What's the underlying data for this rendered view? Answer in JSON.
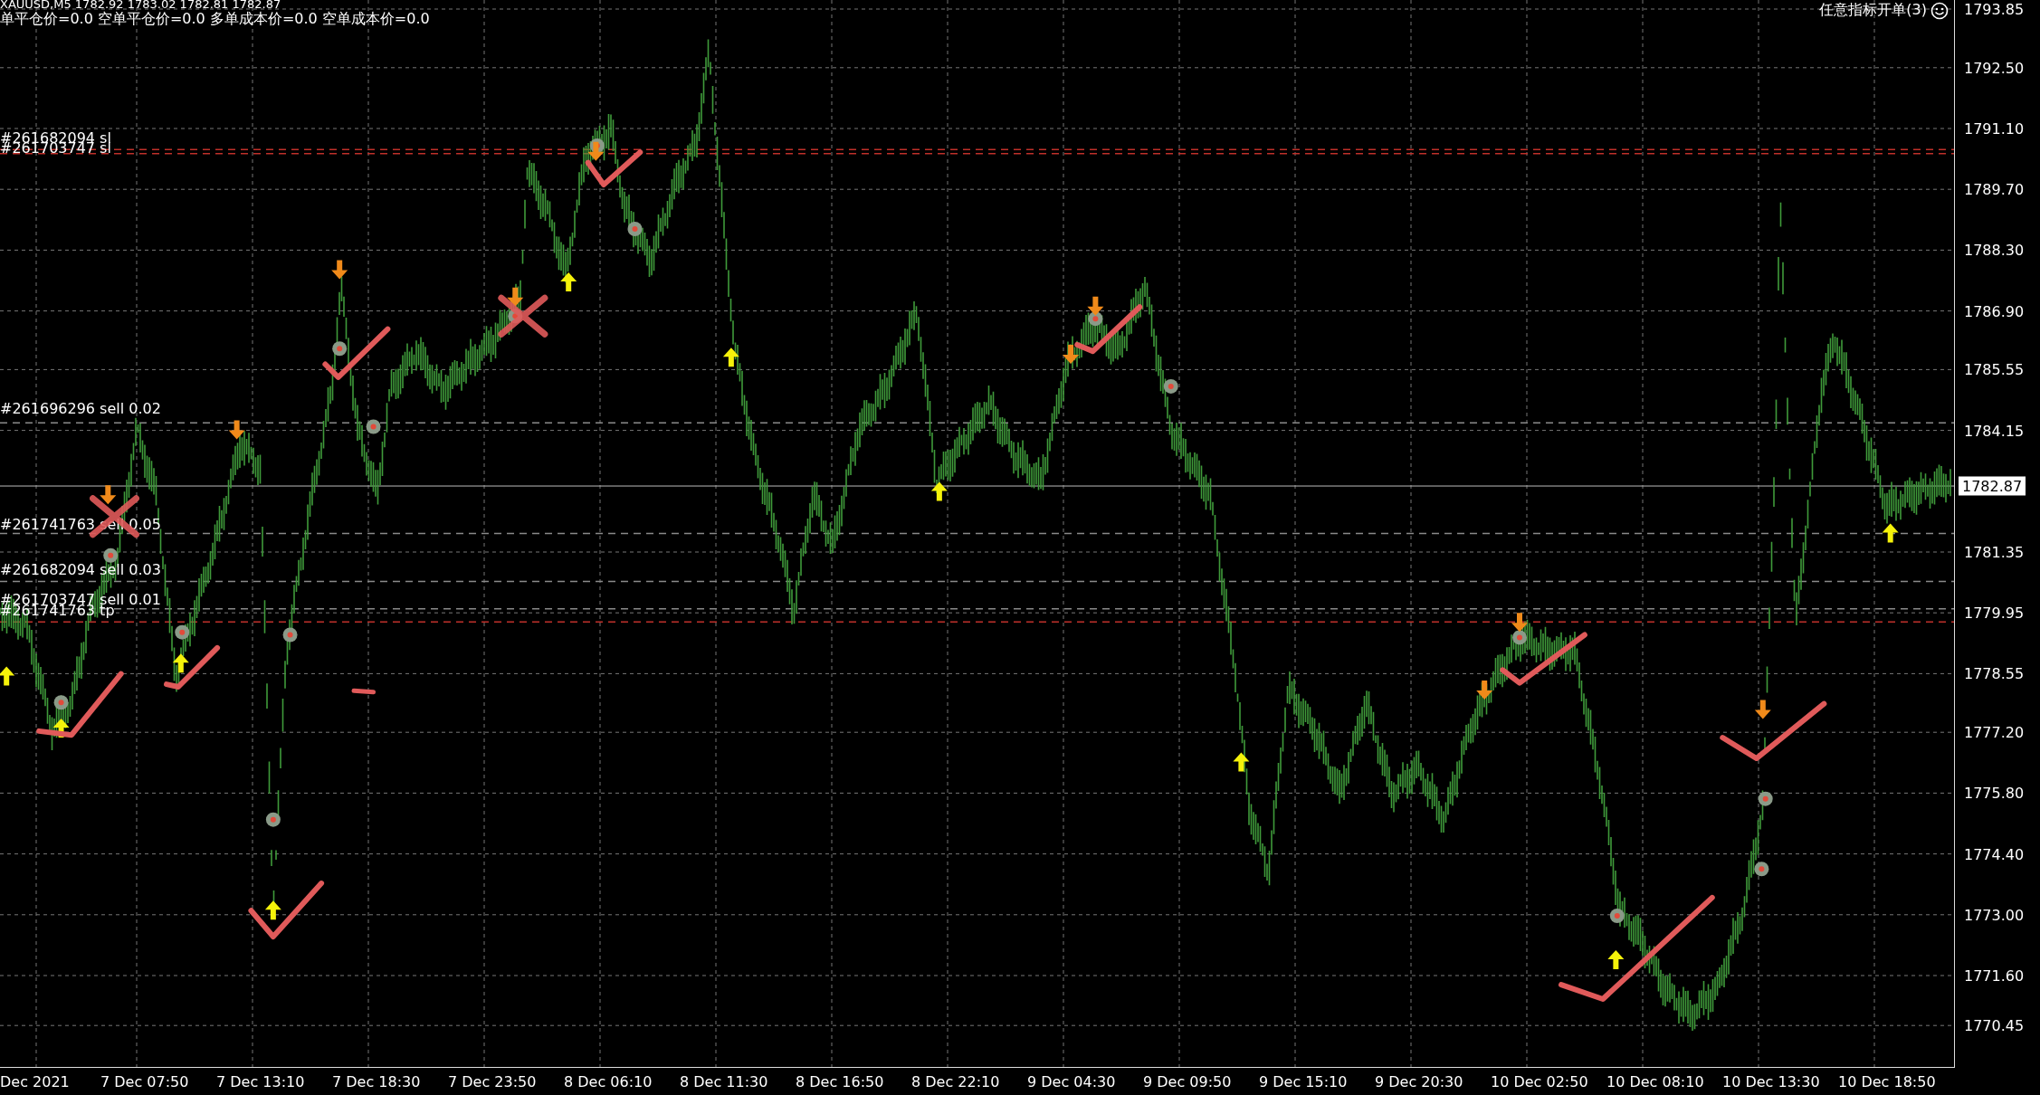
{
  "header": {
    "symbol_line": "XAUUSD,M5  1782.92 1783.02 1782.81 1782.87",
    "info_line": "单平仓价=0.0 空单平仓价=0.0 多单成本价=0.0 空单成本价=0.0"
  },
  "indicator_label": "任意指标开单(3)",
  "order_lines": [
    {
      "label": "#261682094 sl",
      "kind": "sl"
    },
    {
      "label": "#261703747 sl",
      "kind": "sl"
    },
    {
      "label": "#261696296 sell 0.02",
      "kind": "order"
    },
    {
      "label": "#261741763 sell 0.05",
      "kind": "order"
    },
    {
      "label": "#261682094 sell 0.03",
      "kind": "order"
    },
    {
      "label": "#261703747 sell 0.01",
      "kind": "order"
    },
    {
      "label": "#261741763 tp",
      "kind": "tp"
    }
  ],
  "price_axis": {
    "ticks": [
      "1793.85",
      "1792.50",
      "1791.10",
      "1789.70",
      "1788.30",
      "1786.90",
      "1785.55",
      "1784.15",
      "1781.35",
      "1779.95",
      "1778.55",
      "1777.20",
      "1775.80",
      "1774.40",
      "1773.00",
      "1771.60",
      "1770.45"
    ],
    "current_price": "1782.87"
  },
  "time_axis": [
    "Dec 2021",
    "7 Dec 07:50",
    "7 Dec 13:10",
    "7 Dec 18:30",
    "7 Dec 23:50",
    "8 Dec 06:10",
    "8 Dec 11:30",
    "8 Dec 16:50",
    "8 Dec 22:10",
    "9 Dec 04:30",
    "9 Dec 09:50",
    "9 Dec 15:10",
    "9 Dec 20:30",
    "10 Dec 02:50",
    "10 Dec 08:10",
    "10 Dec 13:30",
    "10 Dec 18:50"
  ]
}
